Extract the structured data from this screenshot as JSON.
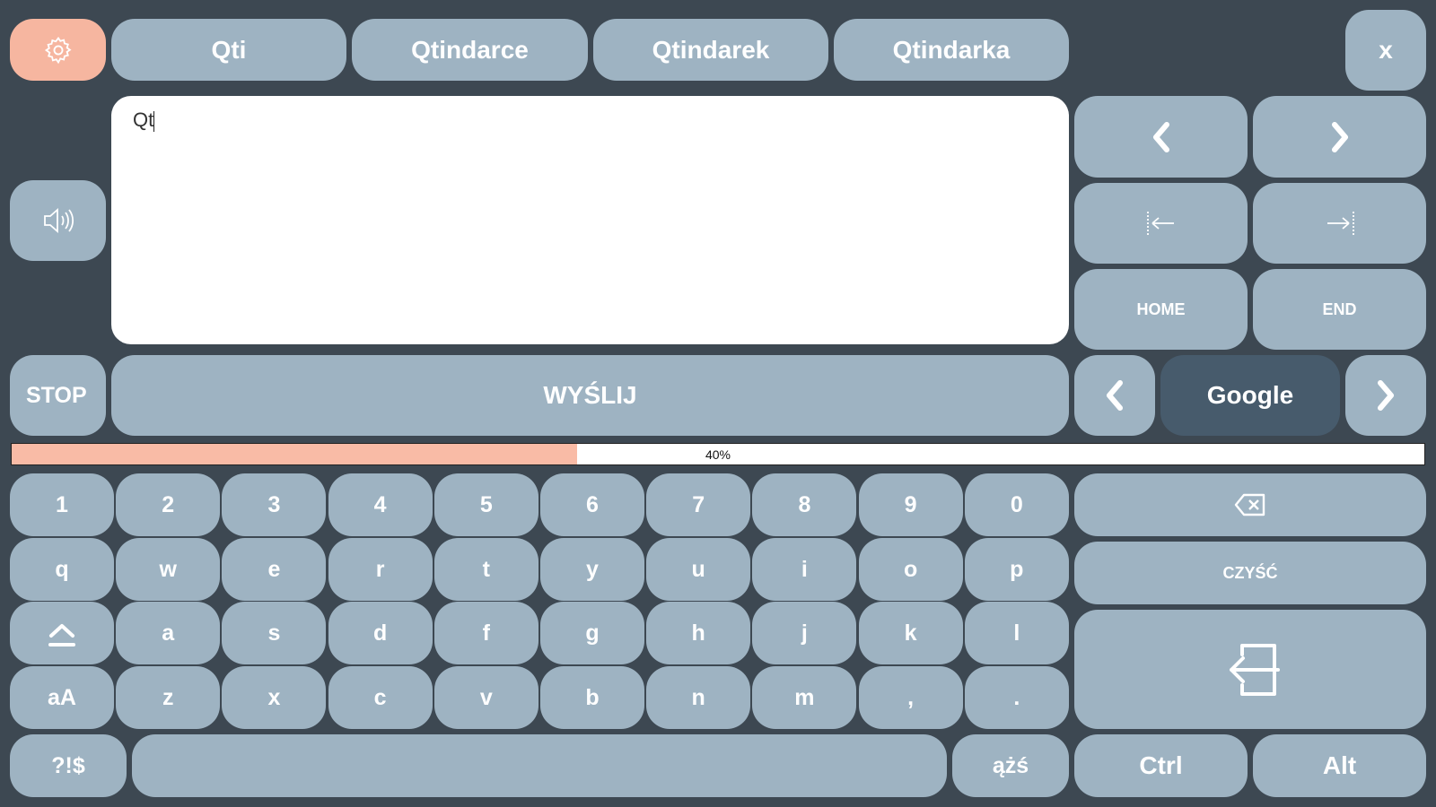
{
  "colors": {
    "background": "#3d4852",
    "key": "#9eb3c2",
    "key_active": "#475b6c",
    "accent": "#f6b6a0",
    "progress_fill": "#f9bba6"
  },
  "suggestions": [
    "Qti",
    "Qtindarce",
    "Qtindarek",
    "Qtindarka"
  ],
  "close_label": "x",
  "text_area": {
    "value": "Qt"
  },
  "nav": {
    "home_label": "HOME",
    "end_label": "END"
  },
  "stop_label": "STOP",
  "send_label": "WYŚLIJ",
  "search_engine": {
    "selected": "Google"
  },
  "progress": {
    "value": 0.4,
    "label": "40%"
  },
  "keyboard": {
    "digits": [
      "1",
      "2",
      "3",
      "4",
      "5",
      "6",
      "7",
      "8",
      "9",
      "0"
    ],
    "row_q": [
      "q",
      "w",
      "e",
      "r",
      "t",
      "y",
      "u",
      "i",
      "o",
      "p"
    ],
    "row_a": [
      "a",
      "s",
      "d",
      "f",
      "g",
      "h",
      "j",
      "k",
      "l"
    ],
    "case_label": "aA",
    "row_z": [
      "z",
      "x",
      "c",
      "v",
      "b",
      "n",
      "m",
      ",",
      "."
    ],
    "clear_label": "CZYŚĆ",
    "symbols_label": "?!$",
    "diacritics_label": "ążś",
    "ctrl_label": "Ctrl",
    "alt_label": "Alt"
  },
  "icons": {
    "settings": "gear-icon",
    "speak": "speaker-icon",
    "prev": "chevron-left-icon",
    "next": "chevron-right-icon",
    "word_left": "arrow-to-start-icon",
    "word_right": "arrow-to-end-icon",
    "shift": "shift-icon",
    "backspace": "backspace-icon",
    "enter": "enter-icon"
  }
}
